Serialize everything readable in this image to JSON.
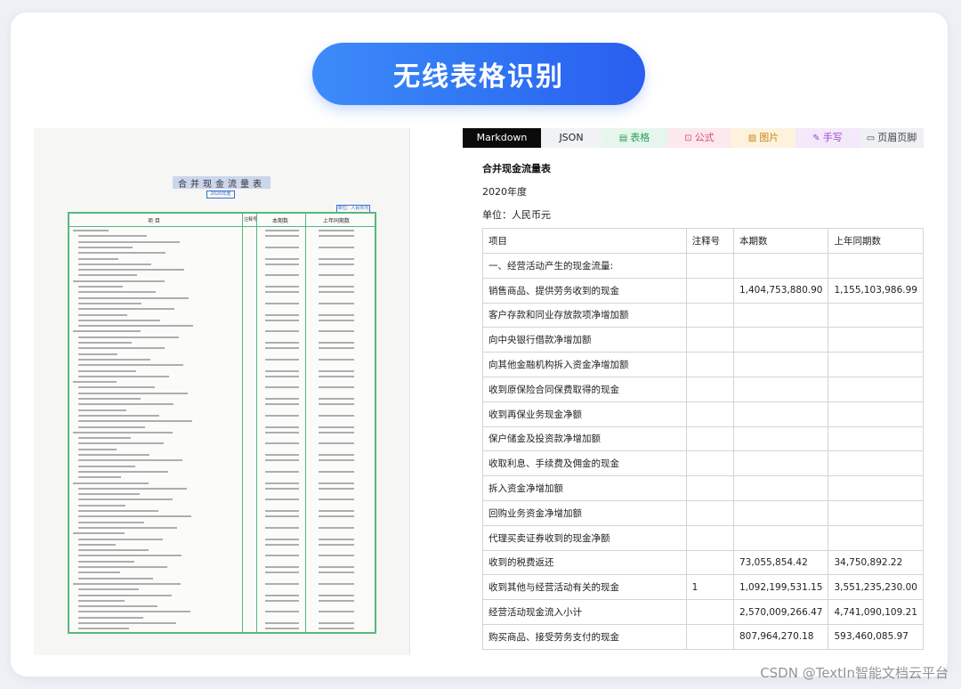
{
  "header": {
    "title": "无线表格识别"
  },
  "scan": {
    "title": "合并现金流量表",
    "year_tag": "2020年度",
    "unit_tag": "单位：人民币元",
    "columns": [
      "项 目",
      "注释号",
      "本期数",
      "上年同期数"
    ]
  },
  "tabs": [
    {
      "label": "Markdown",
      "icon": ""
    },
    {
      "label": "JSON",
      "icon": ""
    },
    {
      "label": "表格",
      "icon": "table-icon"
    },
    {
      "label": "公式",
      "icon": "formula-icon"
    },
    {
      "label": "图片",
      "icon": "image-icon"
    },
    {
      "label": "手写",
      "icon": "handwriting-icon"
    },
    {
      "label": "页眉页脚",
      "icon": "page-icon"
    }
  ],
  "result": {
    "title": "合并现金流量表",
    "year": "2020年度",
    "unit": "单位：人民币元",
    "columns": [
      "项目",
      "注释号",
      "本期数",
      "上年同期数"
    ],
    "rows": [
      [
        "一、经营活动产生的现金流量:",
        "",
        "",
        ""
      ],
      [
        "销售商品、提供劳务收到的现金",
        "",
        "1,404,753,880.90",
        "1,155,103,986.99"
      ],
      [
        "客户存款和同业存放款项净增加额",
        "",
        "",
        ""
      ],
      [
        "向中央银行借款净增加额",
        "",
        "",
        ""
      ],
      [
        "向其他金融机构拆入资金净增加额",
        "",
        "",
        ""
      ],
      [
        "收到原保险合同保费取得的现金",
        "",
        "",
        ""
      ],
      [
        "收到再保业务现金净额",
        "",
        "",
        ""
      ],
      [
        "保户储金及投资款净增加额",
        "",
        "",
        ""
      ],
      [
        "收取利息、手续费及佣金的现金",
        "",
        "",
        ""
      ],
      [
        "拆入资金净增加额",
        "",
        "",
        ""
      ],
      [
        "回购业务资金净增加额",
        "",
        "",
        ""
      ],
      [
        "代理买卖证券收到的现金净额",
        "",
        "",
        ""
      ],
      [
        "收到的税费返还",
        "",
        "73,055,854.42",
        "34,750,892.22"
      ],
      [
        "收到其他与经营活动有关的现金",
        "1",
        "1,092,199,531.15",
        "3,551,235,230.00"
      ],
      [
        "经营活动现金流入小计",
        "",
        "2,570,009,266.47",
        "4,741,090,109.21"
      ],
      [
        "购买商品、接受劳务支付的现金",
        "",
        "807,964,270.18",
        "593,460,085.97"
      ]
    ]
  },
  "watermark": "CSDN @TextIn智能文档云平台",
  "colors": {
    "accent": "#2f74f3",
    "table_border": "#56b97b"
  }
}
